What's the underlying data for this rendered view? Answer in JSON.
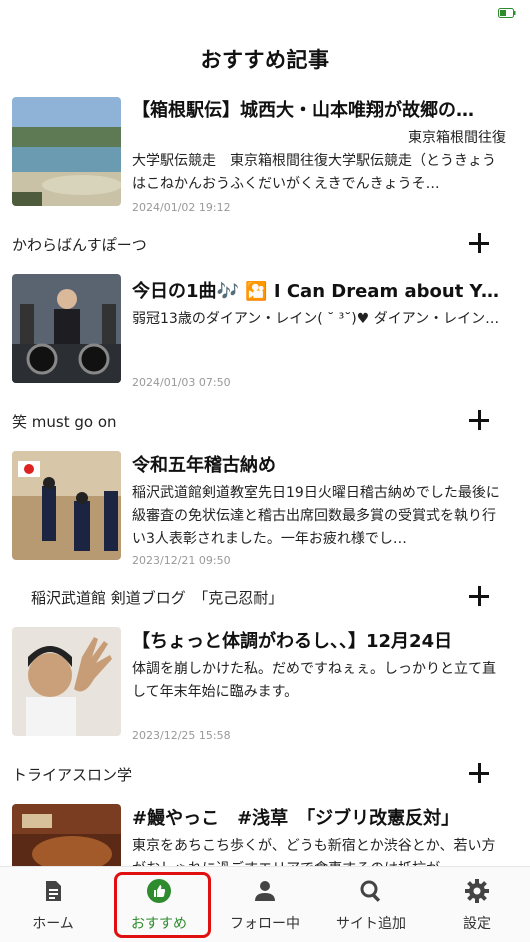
{
  "header": {
    "title": "おすすめ記事"
  },
  "articles": [
    {
      "title": "【箱根駅伝】城西大・山本唯翔が故郷の…",
      "body_lead": "東京箱根間往復",
      "body": "大学駅伝競走　東京箱根間往復大学駅伝競走（とうきょうはこねかんおうふくだいがくえきでんきょうそ…",
      "date": "2024/01/02 19:12",
      "site": "かわらばんすぽーつ"
    },
    {
      "title": "今日の1曲🎶 🎦 I Can Dream about You…",
      "body": "弱冠13歳のダイアン・レイン( ˘ ³˘)♥ ダイアン・レイン…",
      "date": "2024/01/03 07:50",
      "site": "笑 must go on"
    },
    {
      "title": "令和五年稽古納め",
      "body": "稲沢武道館剣道教室先日19日火曜日稽古納めでした最後に級審査の免状伝達と稽古出席回数最多賞の受賞式を執り行い3人表彰されました。一年お疲れ様でし…",
      "date": "2023/12/21 09:50",
      "site": "稲沢武道館 剣道ブログ　「克己忍耐」"
    },
    {
      "title": "【ちょっと体調がわるし、、】12月24日",
      "body": "体調を崩しかけた私。だめですねぇぇ。しっかりと立て直して年末年始に臨みます。",
      "date": "2023/12/25 15:58",
      "site": "トライアスロン学"
    },
    {
      "title": "#鰻やっこ　#浅草　「ジブリ改憲反対」",
      "body": "東京をあちこち歩くが、どうも新宿とか渋谷とか、若い方がおしゃれに過ごすエリアで食事するのは抵抗が…",
      "date": "",
      "site": ""
    }
  ],
  "tabs": [
    {
      "label": "ホーム",
      "icon": "document-icon"
    },
    {
      "label": "おすすめ",
      "icon": "thumbs-up-icon"
    },
    {
      "label": "フォロー中",
      "icon": "person-icon"
    },
    {
      "label": "サイト追加",
      "icon": "search-icon"
    },
    {
      "label": "設定",
      "icon": "gear-icon"
    }
  ],
  "colors": {
    "accent": "#2e8b2e",
    "highlight": "#e01010"
  }
}
